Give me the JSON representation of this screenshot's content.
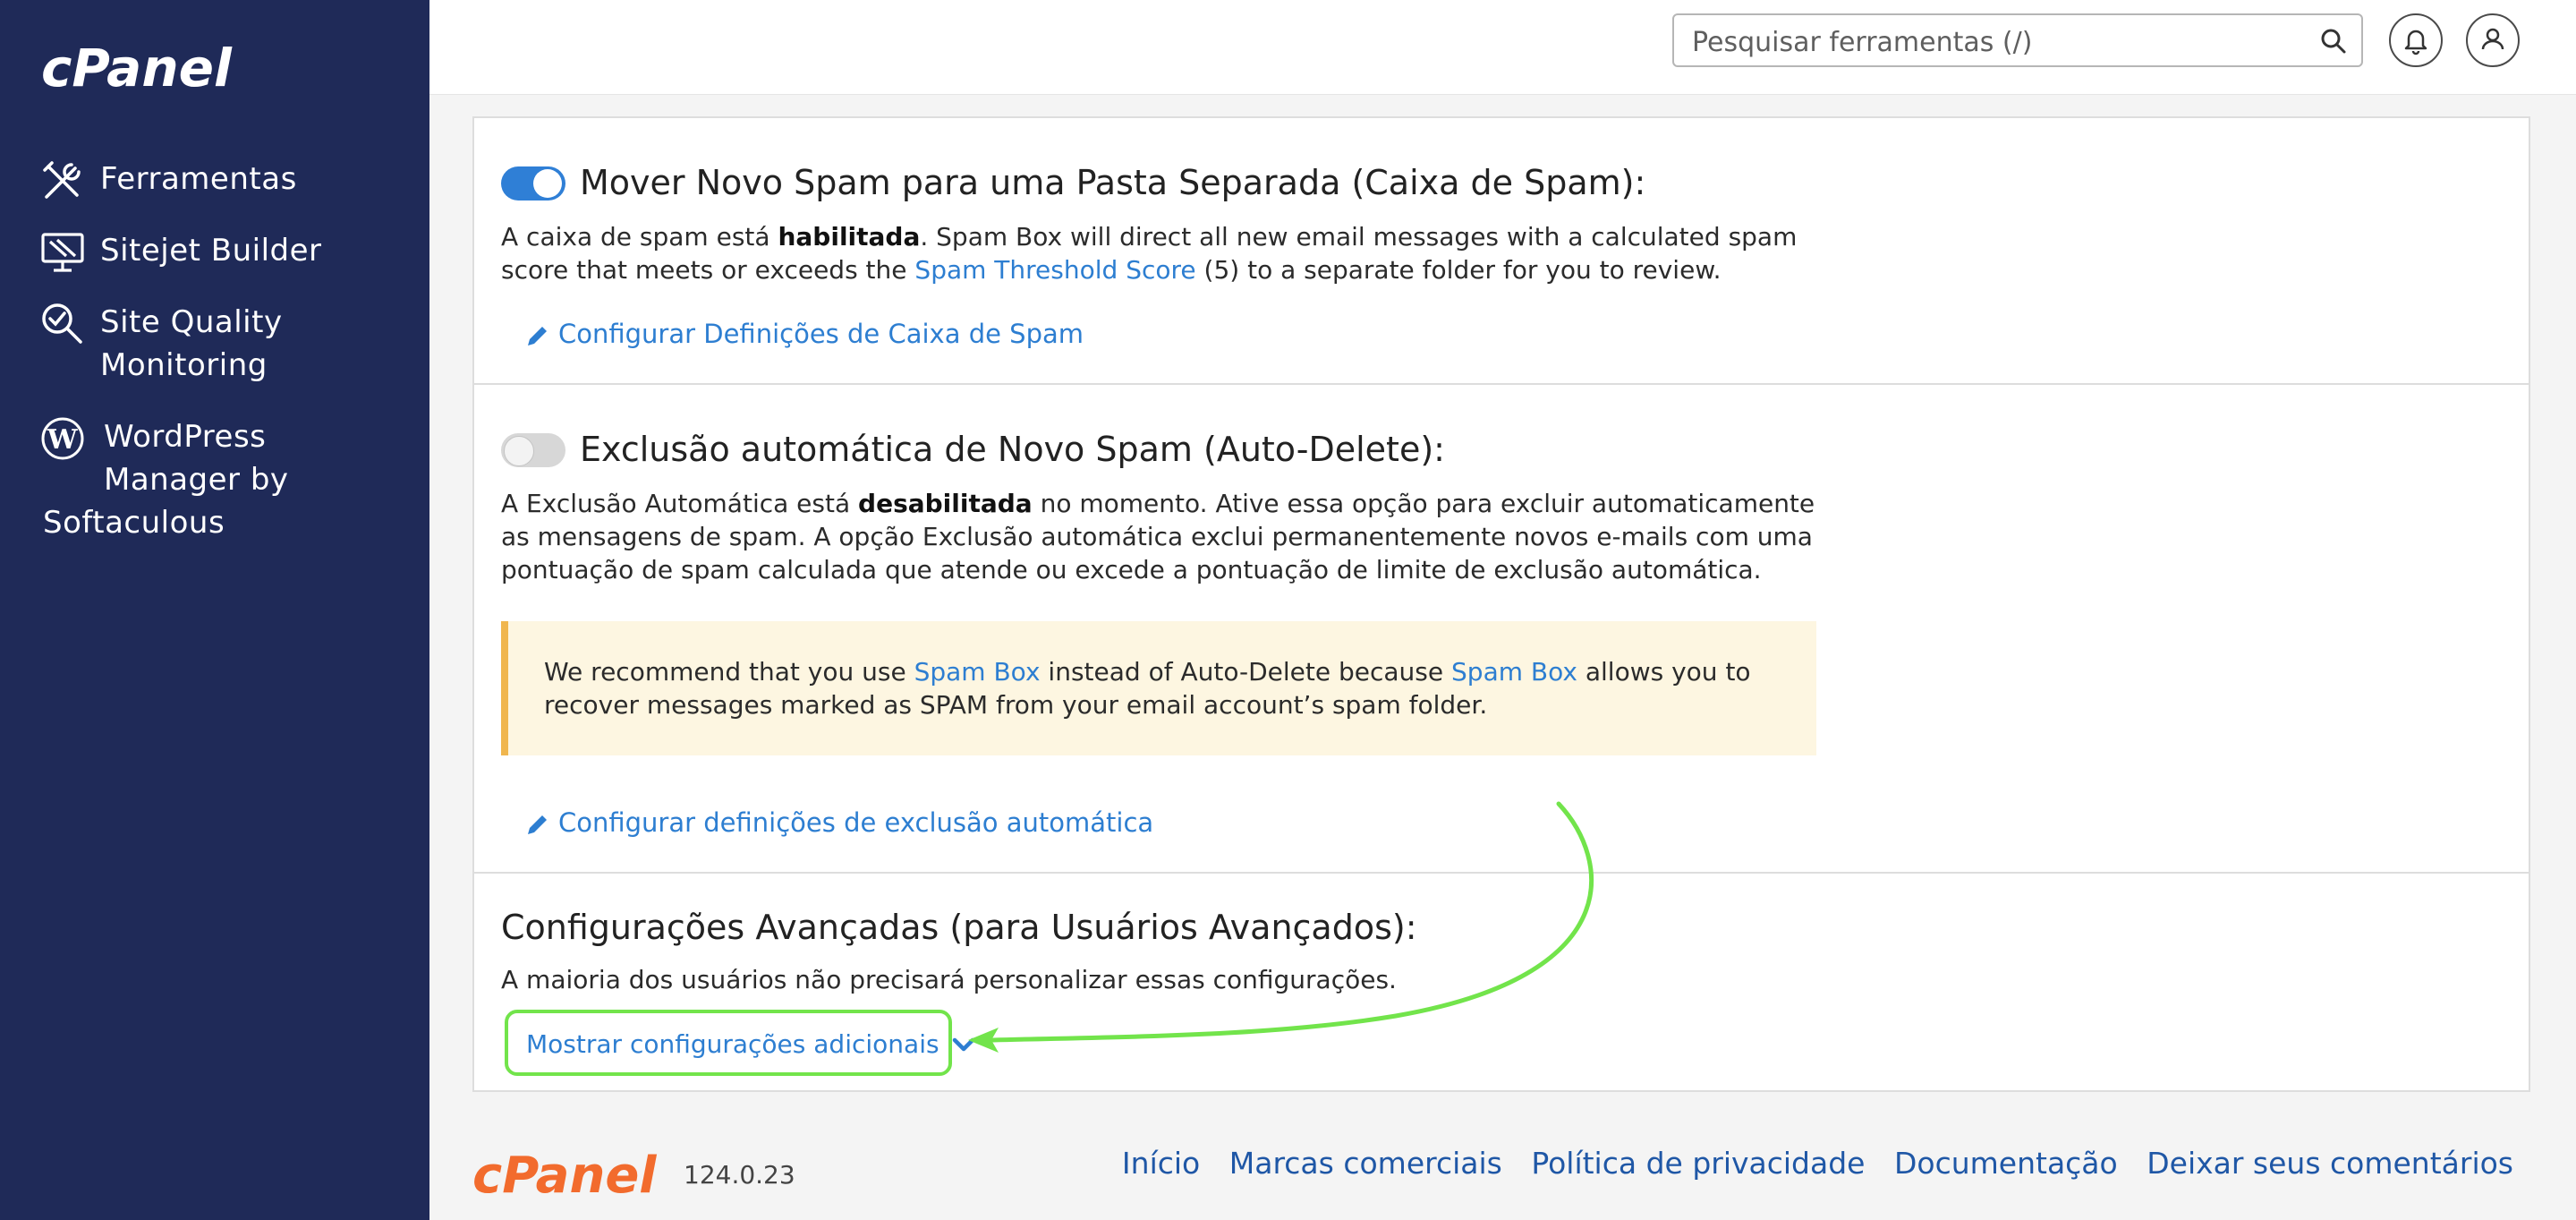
{
  "app": {
    "logo_text": "cPanel",
    "version": "124.0.23"
  },
  "sidebar": {
    "items": [
      {
        "label": "Ferramentas",
        "icon": "tools-icon"
      },
      {
        "label": "Sitejet Builder",
        "icon": "sitejet-monitor-icon"
      },
      {
        "label_line1": "Site Quality",
        "label_line2": "Monitoring",
        "icon": "magnifier-check-icon"
      },
      {
        "label_line1": "WordPress",
        "label_line2": "Manager by",
        "label_line3": "Softaculous",
        "icon": "wordpress-icon"
      }
    ]
  },
  "header": {
    "search_placeholder": "Pesquisar ferramentas (/)",
    "icons": [
      "search-icon",
      "bell-icon",
      "user-icon"
    ]
  },
  "spam_box": {
    "enabled": true,
    "title": "Mover Novo Spam para uma Pasta Separada (Caixa de Spam):",
    "desc_pre": "A caixa de spam está ",
    "desc_bold": "habilitada",
    "desc_mid": ". Spam Box will direct all new email messages with a calculated spam score that meets or exceeds the ",
    "desc_link": "Spam Threshold Score",
    "desc_post": " (5) to a separate folder for you to review.",
    "config_link": "Configurar Definições de Caixa de Spam"
  },
  "auto_delete": {
    "enabled": false,
    "title": "Exclusão automática de Novo Spam (Auto-Delete):",
    "desc_pre": "A Exclusão Automática está ",
    "desc_bold": "desabilitada",
    "desc_post": " no momento. Ative essa opção para excluir automaticamente as mensagens de spam. A opção Exclusão automática exclui permanentemente novos e-mails com uma pontuação de spam calculada que atende ou excede a pontuação de limite de exclusão automática.",
    "warning_pre": "We recommend that you use ",
    "warning_link1": "Spam Box",
    "warning_mid": " instead of Auto-Delete because ",
    "warning_link2": "Spam Box",
    "warning_post": " allows you to recover messages marked as SPAM from your email account’s spam folder.",
    "config_link": "Configurar definições de exclusão automática"
  },
  "advanced": {
    "title": "Configurações Avançadas (para Usuários Avançados):",
    "desc": "A maioria dos usuários não precisará personalizar essas configurações.",
    "show_more": "Mostrar configurações adicionais"
  },
  "footer": {
    "links": [
      "Início",
      "Marcas comerciais",
      "Política de privacidade",
      "Documentação",
      "Deixar seus comentários"
    ]
  },
  "colors": {
    "sidebar_bg": "#1f2a58",
    "link": "#2d7ed1",
    "toggle_on": "#2f7fd6",
    "toggle_off": "#d7d7d7",
    "warning_bg": "#fdf6e1",
    "warning_border": "#f0b64e",
    "annotation": "#72e44b",
    "brand_orange": "#f26b2d"
  }
}
